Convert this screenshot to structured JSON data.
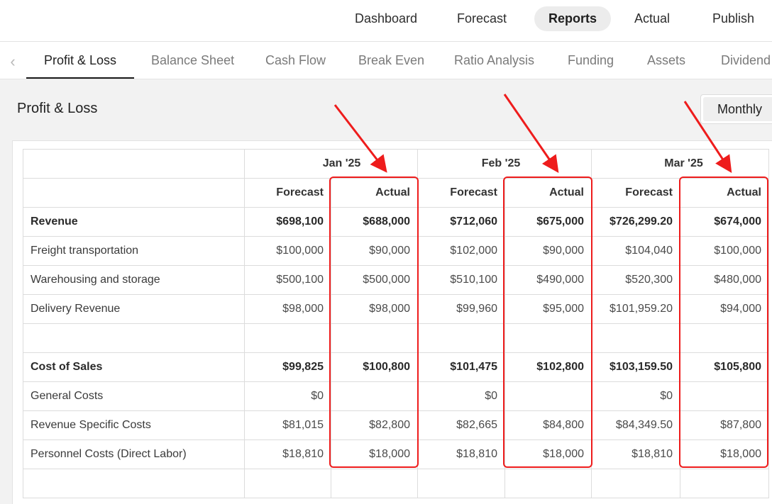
{
  "topnav": {
    "items": [
      {
        "label": "Dashboard",
        "active": false
      },
      {
        "label": "Forecast",
        "active": false
      },
      {
        "label": "Reports",
        "active": true
      },
      {
        "label": "Actual",
        "active": false
      },
      {
        "label": "Publish",
        "active": false
      }
    ]
  },
  "subtabs": {
    "back_icon": "chevron-left-icon",
    "items": [
      {
        "label": "Profit & Loss",
        "active": true
      },
      {
        "label": "Balance Sheet",
        "active": false
      },
      {
        "label": "Cash Flow",
        "active": false
      },
      {
        "label": "Break Even",
        "active": false
      },
      {
        "label": "Ratio Analysis",
        "active": false
      },
      {
        "label": "Funding",
        "active": false
      },
      {
        "label": "Assets",
        "active": false
      },
      {
        "label": "Dividend",
        "active": false
      }
    ]
  },
  "section": {
    "title": "Profit & Loss",
    "period": "Monthly"
  },
  "table": {
    "months": [
      "Jan '25",
      "Feb '25",
      "Mar '25"
    ],
    "subheaders": [
      "Forecast",
      "Actual"
    ],
    "rows": [
      {
        "label": "Revenue",
        "bold": true,
        "values": [
          "$698,100",
          "$688,000",
          "$712,060",
          "$675,000",
          "$726,299.20",
          "$674,000"
        ]
      },
      {
        "label": "Freight transportation",
        "bold": false,
        "values": [
          "$100,000",
          "$90,000",
          "$102,000",
          "$90,000",
          "$104,040",
          "$100,000"
        ]
      },
      {
        "label": "Warehousing and storage",
        "bold": false,
        "values": [
          "$500,100",
          "$500,000",
          "$510,100",
          "$490,000",
          "$520,300",
          "$480,000"
        ]
      },
      {
        "label": "Delivery Revenue",
        "bold": false,
        "values": [
          "$98,000",
          "$98,000",
          "$99,960",
          "$95,000",
          "$101,959.20",
          "$94,000"
        ]
      },
      {
        "label": "",
        "bold": false,
        "values": [
          "",
          "",
          "",
          "",
          "",
          ""
        ]
      },
      {
        "label": "Cost of Sales",
        "bold": true,
        "values": [
          "$99,825",
          "$100,800",
          "$101,475",
          "$102,800",
          "$103,159.50",
          "$105,800"
        ]
      },
      {
        "label": "General Costs",
        "bold": false,
        "values": [
          "$0",
          "",
          "$0",
          "",
          "$0",
          ""
        ]
      },
      {
        "label": "Revenue Specific Costs",
        "bold": false,
        "values": [
          "$81,015",
          "$82,800",
          "$82,665",
          "$84,800",
          "$84,349.50",
          "$87,800"
        ]
      },
      {
        "label": "Personnel Costs (Direct Labor)",
        "bold": false,
        "values": [
          "$18,810",
          "$18,000",
          "$18,810",
          "$18,000",
          "$18,810",
          "$18,000"
        ]
      },
      {
        "label": "",
        "bold": false,
        "values": [
          "",
          "",
          "",
          "",
          "",
          ""
        ]
      }
    ]
  },
  "annotation": {
    "color": "#ee1c1c"
  }
}
